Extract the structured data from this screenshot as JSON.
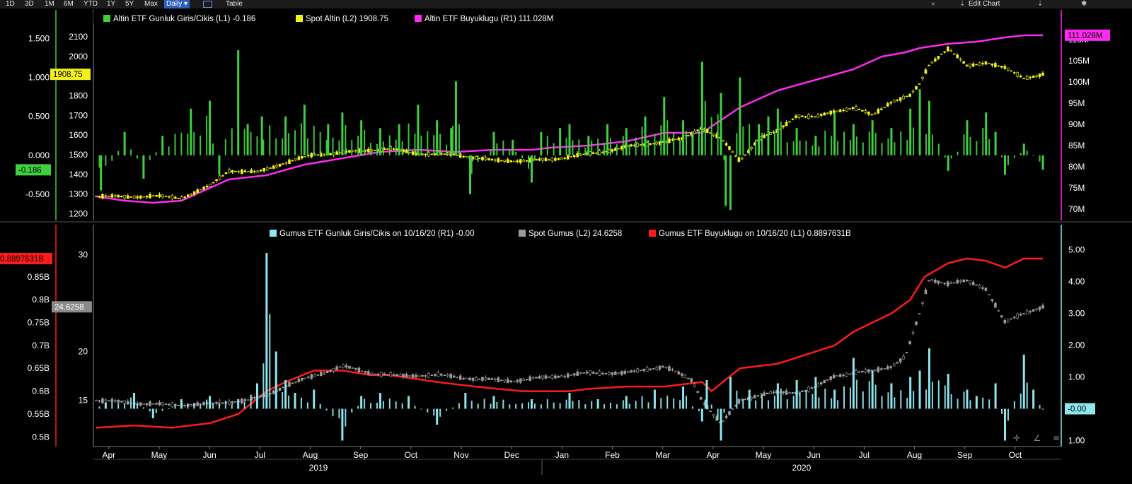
{
  "toolbar": {
    "ranges": [
      "1D",
      "3D",
      "1M",
      "6M",
      "YTD",
      "1Y",
      "5Y",
      "Max"
    ],
    "frequency": "Daily ▾",
    "table_label": "Table",
    "edit_chart_label": "Edit Chart",
    "collapse_icon": "double-chevron-left-icon",
    "settings_icon": "gear-icon"
  },
  "colors": {
    "altin_flow": "#3fcf3f",
    "spot_altin": "#f2f21a",
    "altin_size": "#ff2bf2",
    "gumus_flow": "#8ee6ee",
    "spot_gumus": "#9a9a9a",
    "gumus_size": "#ff1a1a",
    "background": "#000000"
  },
  "chart_data": [
    {
      "type": "line",
      "panel": "top",
      "legend": {
        "altin_flow": "Altin ETF Gunluk Giris/Cikis (L1) -0.186",
        "spot_altin": "Spot Altin (L2) 1908.75",
        "altin_size": "Altin ETF Buyuklugu (R1) 111.028M"
      },
      "axes": {
        "L1": {
          "ticks": [
            "1.500",
            "1.000",
            "0.500",
            "0.000",
            "-0.500"
          ],
          "range": [
            -0.8,
            1.65
          ]
        },
        "L2": {
          "ticks": [
            "2100",
            "2000",
            "1900",
            "1800",
            "1700",
            "1600",
            "1500",
            "1400",
            "1300",
            "1200"
          ],
          "range": [
            1180,
            2150
          ]
        },
        "R1": {
          "ticks": [
            "110M",
            "105M",
            "100M",
            "95M",
            "90M",
            "85M",
            "80M",
            "75M",
            "70M"
          ],
          "range": [
            68,
            113
          ]
        }
      },
      "last_value_tags": {
        "spot_altin": "1908.75",
        "altin_flow": "-0.186",
        "altin_size": "111.028M"
      },
      "series": [
        {
          "name": "Altin ETF Buyuklugu",
          "axis": "R1",
          "kind": "line",
          "x": [
            0,
            0.03,
            0.06,
            0.09,
            0.12,
            0.14,
            0.18,
            0.22,
            0.26,
            0.3,
            0.34,
            0.38,
            0.42,
            0.46,
            0.48,
            0.52,
            0.56,
            0.6,
            0.64,
            0.68,
            0.72,
            0.76,
            0.8,
            0.83,
            0.855,
            0.87,
            0.9,
            0.93,
            0.96,
            0.98,
            1.0
          ],
          "values": [
            73,
            72,
            71.5,
            72,
            75,
            77,
            78,
            80.5,
            82,
            83.5,
            84,
            83.5,
            84,
            84,
            84.5,
            85,
            86,
            88,
            88,
            94,
            98,
            100.5,
            103,
            106,
            107,
            108,
            109,
            109.5,
            110.5,
            111,
            111.03
          ]
        },
        {
          "name": "Spot Altin",
          "axis": "L2",
          "kind": "candles",
          "x": [
            0,
            0.03,
            0.06,
            0.09,
            0.12,
            0.14,
            0.17,
            0.2,
            0.23,
            0.26,
            0.29,
            0.31,
            0.34,
            0.38,
            0.42,
            0.46,
            0.48,
            0.5,
            0.53,
            0.56,
            0.59,
            0.62,
            0.64,
            0.66,
            0.68,
            0.7,
            0.72,
            0.74,
            0.76,
            0.78,
            0.8,
            0.82,
            0.84,
            0.86,
            0.87,
            0.88,
            0.9,
            0.92,
            0.94,
            0.96,
            0.98,
            1.0
          ],
          "values": [
            1290,
            1285,
            1290,
            1280,
            1340,
            1420,
            1410,
            1460,
            1500,
            1510,
            1525,
            1530,
            1505,
            1500,
            1470,
            1470,
            1475,
            1490,
            1510,
            1540,
            1560,
            1580,
            1640,
            1580,
            1470,
            1580,
            1620,
            1700,
            1690,
            1720,
            1740,
            1700,
            1770,
            1800,
            1860,
            1960,
            2040,
            1950,
            1970,
            1940,
            1890,
            1908.75
          ]
        },
        {
          "name": "Altin ETF Gunluk Giris/Cikis",
          "axis": "L1",
          "kind": "bars",
          "x": [
            0.005,
            0.03,
            0.05,
            0.07,
            0.1,
            0.12,
            0.13,
            0.15,
            0.16,
            0.175,
            0.2,
            0.22,
            0.245,
            0.26,
            0.28,
            0.3,
            0.32,
            0.34,
            0.36,
            0.375,
            0.38,
            0.395,
            0.42,
            0.44,
            0.46,
            0.47,
            0.49,
            0.5,
            0.52,
            0.54,
            0.56,
            0.58,
            0.6,
            0.62,
            0.63,
            0.64,
            0.66,
            0.665,
            0.67,
            0.68,
            0.7,
            0.71,
            0.72,
            0.74,
            0.76,
            0.78,
            0.8,
            0.82,
            0.84,
            0.86,
            0.87,
            0.88,
            0.9,
            0.92,
            0.94,
            0.95,
            0.96,
            0.98,
            1.0
          ],
          "values": [
            -0.45,
            0.3,
            -0.3,
            0.25,
            0.6,
            0.7,
            -0.25,
            1.35,
            0.4,
            0.5,
            0.5,
            0.65,
            0.4,
            0.55,
            0.45,
            0.35,
            0.4,
            0.65,
            0.45,
            0.35,
            0.95,
            -0.5,
            0.3,
            0.2,
            -0.35,
            0.3,
            0.35,
            0.4,
            0.25,
            0.4,
            0.35,
            0.5,
            0.75,
            0.45,
            0.3,
            1.2,
            0.8,
            -0.65,
            -0.7,
            1.0,
            0.4,
            0.5,
            0.6,
            0.35,
            0.25,
            0.55,
            0.4,
            0.45,
            0.35,
            0.6,
            0.85,
            0.7,
            -0.2,
            0.45,
            0.55,
            0.3,
            -0.25,
            0.15,
            -0.186
          ]
        }
      ]
    },
    {
      "type": "line",
      "panel": "bottom",
      "legend": {
        "gumus_flow": "Gumus ETF Gunluk Giris/Cikis on 10/16/20 (R1) -0.00",
        "spot_gumus": "Spot Gumus (L2) 24.6258",
        "gumus_size": "Gumus ETF Buyuklugu on 10/16/20 (L1) 0.8897631B"
      },
      "axes": {
        "L1": {
          "ticks": [
            "0.85B",
            "0.8B",
            "0.75B",
            "0.7B",
            "0.65B",
            "0.6B",
            "0.55B",
            "0.5B"
          ],
          "range": [
            0.485,
            0.93
          ]
        },
        "L2": {
          "ticks": [
            "30",
            "20",
            "15"
          ],
          "range": [
            10.5,
            31.5
          ]
        },
        "R1": {
          "ticks": [
            "5.00",
            "4.00",
            "3.00",
            "2.00",
            "1.00",
            "1.00"
          ],
          "range": [
            -1.1,
            5.3
          ]
        }
      },
      "last_value_tags": {
        "gumus_size": "0.8897631B",
        "spot_gumus": "24.6258",
        "gumus_flow": "-0.00"
      },
      "series": [
        {
          "name": "Gumus ETF Buyuklugu",
          "axis": "L1",
          "kind": "line",
          "x": [
            0,
            0.04,
            0.08,
            0.12,
            0.15,
            0.18,
            0.2,
            0.23,
            0.26,
            0.29,
            0.31,
            0.36,
            0.4,
            0.45,
            0.5,
            0.52,
            0.56,
            0.6,
            0.64,
            0.65,
            0.68,
            0.7,
            0.72,
            0.75,
            0.78,
            0.8,
            0.82,
            0.84,
            0.86,
            0.875,
            0.9,
            0.92,
            0.94,
            0.96,
            0.98,
            1.0
          ],
          "values": [
            0.52,
            0.525,
            0.52,
            0.53,
            0.55,
            0.6,
            0.62,
            0.645,
            0.645,
            0.635,
            0.635,
            0.62,
            0.61,
            0.6,
            0.6,
            0.605,
            0.61,
            0.61,
            0.62,
            0.6,
            0.65,
            0.655,
            0.66,
            0.68,
            0.7,
            0.73,
            0.75,
            0.77,
            0.8,
            0.85,
            0.88,
            0.89,
            0.885,
            0.87,
            0.89,
            0.8898
          ]
        },
        {
          "name": "Spot Gumus",
          "axis": "L2",
          "kind": "candles",
          "x": [
            0,
            0.04,
            0.08,
            0.12,
            0.16,
            0.18,
            0.2,
            0.23,
            0.26,
            0.29,
            0.32,
            0.36,
            0.4,
            0.44,
            0.48,
            0.52,
            0.56,
            0.6,
            0.63,
            0.64,
            0.66,
            0.68,
            0.7,
            0.72,
            0.74,
            0.76,
            0.78,
            0.8,
            0.82,
            0.84,
            0.855,
            0.87,
            0.88,
            0.9,
            0.92,
            0.94,
            0.96,
            0.98,
            1.0
          ],
          "values": [
            15,
            14.7,
            14.5,
            14.6,
            15,
            15.5,
            16.5,
            17.5,
            18.5,
            17.8,
            17.5,
            17.6,
            17.2,
            17,
            17.4,
            17.8,
            17.8,
            18.5,
            17,
            15,
            12.5,
            15,
            15.5,
            15.8,
            15.8,
            16.3,
            17.5,
            17.8,
            18,
            18.5,
            19.5,
            24,
            27.5,
            27,
            27.3,
            26.5,
            23,
            24,
            24.6258
          ]
        },
        {
          "name": "Gumus ETF Gunluk Giris/Cikis",
          "axis": "R1",
          "kind": "bars",
          "x": [
            0.01,
            0.04,
            0.06,
            0.09,
            0.12,
            0.15,
            0.17,
            0.18,
            0.19,
            0.2,
            0.21,
            0.23,
            0.26,
            0.28,
            0.3,
            0.33,
            0.36,
            0.39,
            0.42,
            0.46,
            0.5,
            0.53,
            0.56,
            0.59,
            0.62,
            0.64,
            0.645,
            0.66,
            0.67,
            0.69,
            0.72,
            0.74,
            0.76,
            0.78,
            0.8,
            0.82,
            0.84,
            0.86,
            0.87,
            0.88,
            0.9,
            0.92,
            0.93,
            0.95,
            0.96,
            0.98,
            0.99,
            1.0
          ],
          "values": [
            0.2,
            0.5,
            -0.3,
            0.3,
            0.4,
            0.3,
            0.8,
            4.9,
            1.8,
            0.9,
            0.5,
            0.6,
            -1.0,
            0.4,
            0.5,
            0.4,
            -0.5,
            0.5,
            0.4,
            0.3,
            0.5,
            0.3,
            0.4,
            0.6,
            0.7,
            -0.4,
            0.9,
            -1.0,
            1.0,
            0.6,
            0.8,
            0.9,
            1.0,
            0.6,
            1.6,
            1.2,
            0.8,
            1.0,
            1.2,
            1.9,
            1.1,
            0.6,
            0.4,
            0.8,
            -1.0,
            1.7,
            0.6,
            -0.0
          ]
        }
      ]
    }
  ],
  "x_axis": {
    "months": [
      "Apr",
      "May",
      "Jun",
      "Jul",
      "Aug",
      "Sep",
      "Oct",
      "Nov",
      "Dec",
      "Jan",
      "Feb",
      "Mar",
      "Apr",
      "May",
      "Jun",
      "Jul",
      "Aug",
      "Sep",
      "Oct"
    ],
    "years": [
      "2019",
      "2020"
    ]
  },
  "controls": {
    "crosshair_icon": "crosshair-icon",
    "draw_icon": "pencil-icon",
    "menu_icon": "list-icon",
    "zoom_icon": "zoom-icon"
  }
}
